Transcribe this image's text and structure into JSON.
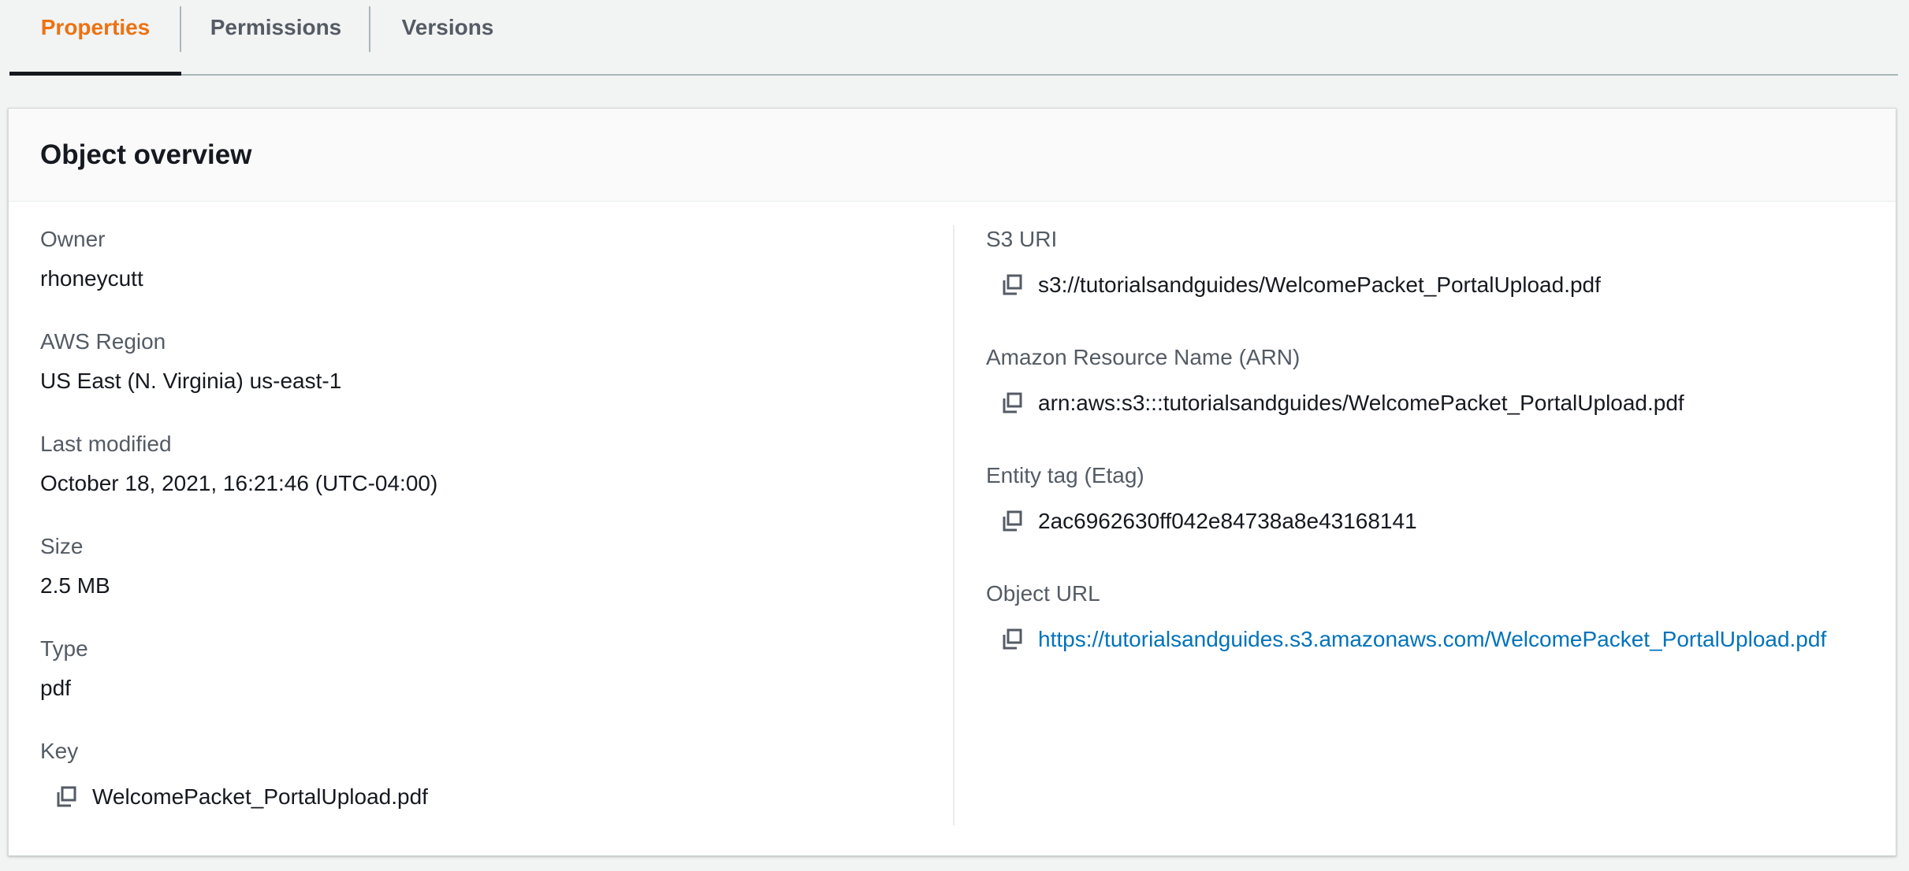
{
  "tabs": [
    {
      "label": "Properties",
      "active": true
    },
    {
      "label": "Permissions",
      "active": false
    },
    {
      "label": "Versions",
      "active": false
    }
  ],
  "panel": {
    "title": "Object overview"
  },
  "left": {
    "owner": {
      "label": "Owner",
      "value": "rhoneycutt"
    },
    "region": {
      "label": "AWS Region",
      "value": "US East (N. Virginia) us-east-1"
    },
    "modified": {
      "label": "Last modified",
      "value": "October 18, 2021, 16:21:46 (UTC-04:00)"
    },
    "size": {
      "label": "Size",
      "value": "2.5 MB"
    },
    "type": {
      "label": "Type",
      "value": "pdf"
    },
    "key": {
      "label": "Key",
      "value": "WelcomePacket_PortalUpload.pdf"
    }
  },
  "right": {
    "s3uri": {
      "label": "S3 URI",
      "value": "s3://tutorialsandguides/WelcomePacket_PortalUpload.pdf"
    },
    "arn": {
      "label": "Amazon Resource Name (ARN)",
      "value": "arn:aws:s3:::tutorialsandguides/WelcomePacket_PortalUpload.pdf"
    },
    "etag": {
      "label": "Entity tag (Etag)",
      "value": "2ac6962630ff042e84738a8e43168141"
    },
    "url": {
      "label": "Object URL",
      "value": "https://tutorialsandguides.s3.amazonaws.com/WelcomePacket_PortalUpload.pdf"
    }
  },
  "icons": {
    "copy": "copy-icon"
  },
  "colors": {
    "accent": "#ec7211",
    "link": "#0073bb",
    "text": "#16191f",
    "label": "#545b64"
  }
}
